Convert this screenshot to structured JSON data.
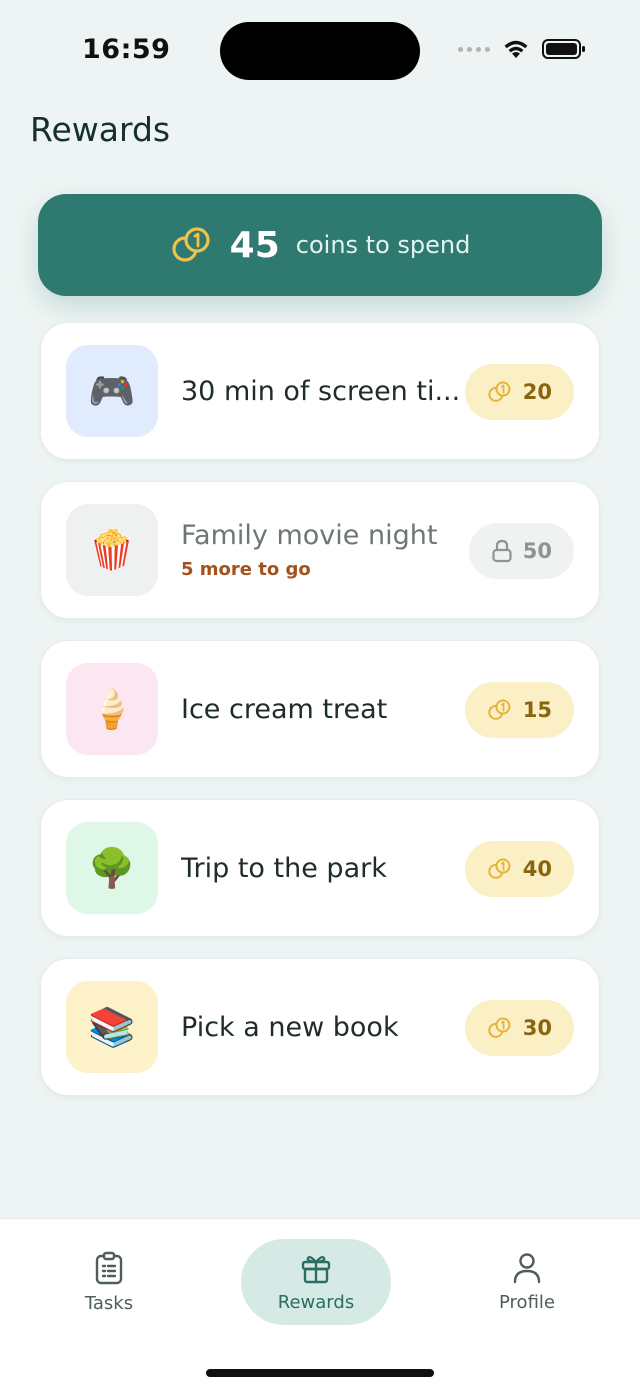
{
  "status_bar": {
    "time": "16:59"
  },
  "header": {
    "title": "Rewards"
  },
  "balance": {
    "icon": "coins-icon",
    "amount": "45",
    "caption": "coins to spend",
    "color": "#2e7a70"
  },
  "rewards": [
    {
      "emoji": "🎮",
      "tile_color": "#e0ebfd",
      "title": "30 min of screen ti...",
      "subtitle": "",
      "cost": "20",
      "locked": false
    },
    {
      "emoji": "🍿",
      "tile_color": "#eef1f0",
      "title": "Family movie night",
      "subtitle": "5 more to go",
      "cost": "50",
      "locked": true
    },
    {
      "emoji": "🍦",
      "tile_color": "#fce6f1",
      "title": "Ice cream treat",
      "subtitle": "",
      "cost": "15",
      "locked": false
    },
    {
      "emoji": "🌳",
      "tile_color": "#dff7e6",
      "title": "Trip to the park",
      "subtitle": "",
      "cost": "40",
      "locked": false
    },
    {
      "emoji": "📚",
      "tile_color": "#fcf1c8",
      "title": "Pick a new book",
      "subtitle": "",
      "cost": "30",
      "locked": false
    }
  ],
  "tab_bar": {
    "tabs": [
      {
        "label": "Tasks",
        "icon": "clipboard-icon",
        "active": false
      },
      {
        "label": "Rewards",
        "icon": "gift-icon",
        "active": true
      },
      {
        "label": "Profile",
        "icon": "person-icon",
        "active": false
      }
    ]
  }
}
